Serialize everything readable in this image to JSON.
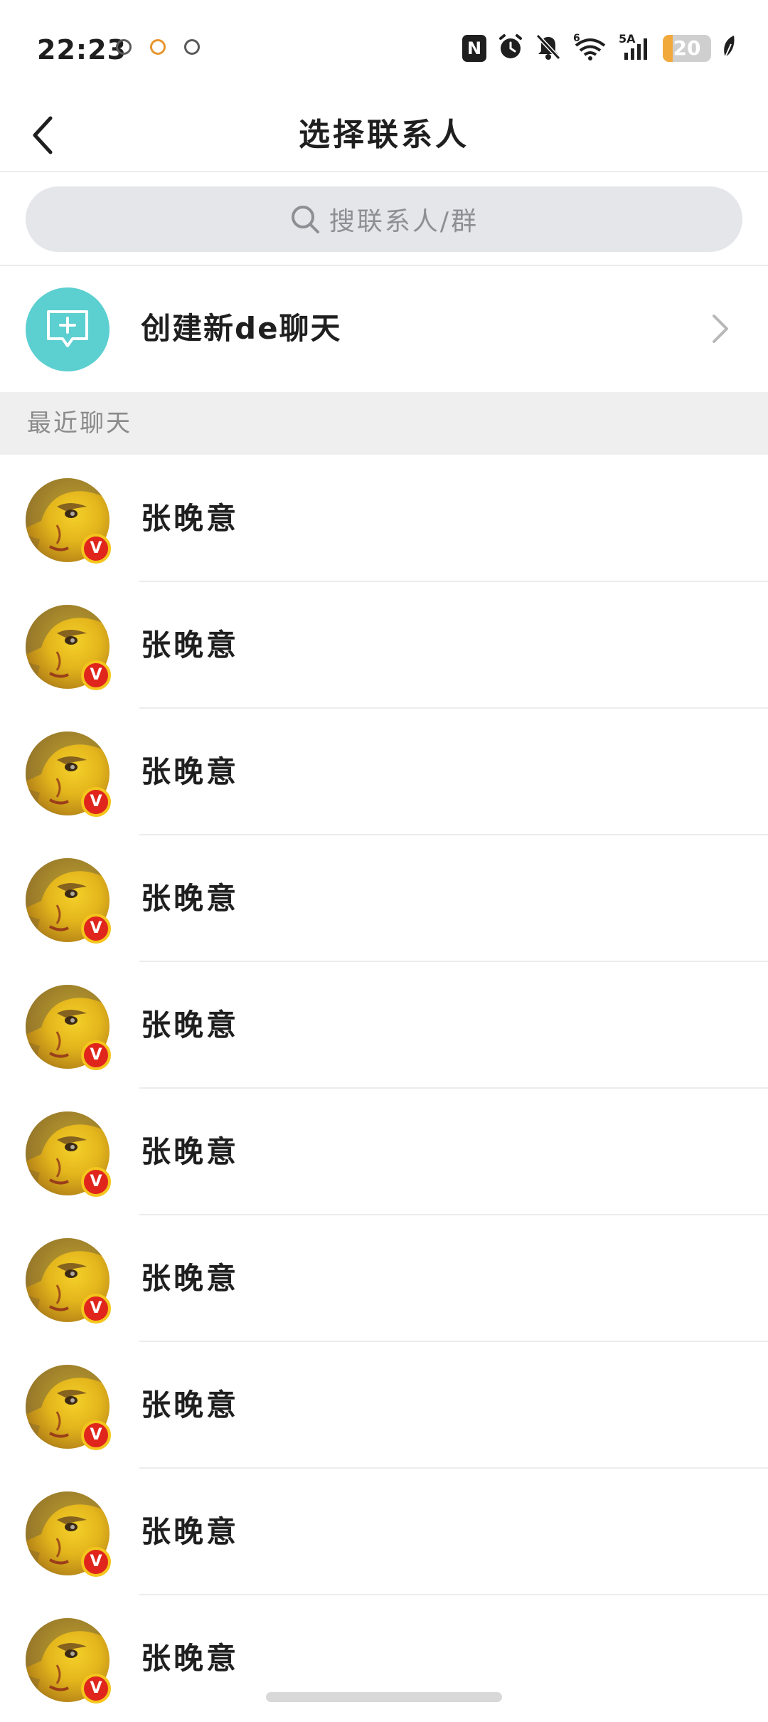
{
  "status_bar": {
    "time": "22:23",
    "network_label": "5A",
    "wifi_label": "6",
    "battery_text": "20",
    "battery_level_percent": 20,
    "app_icons": [
      "notification-app-icon",
      "notification-app-icon",
      "notification-app-icon"
    ],
    "right_icons": [
      "nfc-icon",
      "alarm-icon",
      "mute-icon",
      "wifi-icon",
      "signal-icon",
      "battery-icon",
      "leaf-icon"
    ]
  },
  "header": {
    "title": "选择联系人",
    "back_icon": "back-arrow-icon"
  },
  "search": {
    "placeholder": "搜联系人/群",
    "icon": "search-icon"
  },
  "create_chat": {
    "label": "创建新de聊天",
    "icon": "add-chat-icon",
    "accent_color": "#5ccfd0"
  },
  "recent_section": {
    "title": "最近聊天"
  },
  "contacts": [
    {
      "name": "张晚意",
      "badge": "V"
    },
    {
      "name": "张晚意",
      "badge": "V"
    },
    {
      "name": "张晚意",
      "badge": "V"
    },
    {
      "name": "张晚意",
      "badge": "V"
    },
    {
      "name": "张晚意",
      "badge": "V"
    },
    {
      "name": "张晚意",
      "badge": "V"
    },
    {
      "name": "张晚意",
      "badge": "V"
    },
    {
      "name": "张晚意",
      "badge": "V"
    },
    {
      "name": "张晚意",
      "badge": "V"
    },
    {
      "name": "张晚意",
      "badge": "V"
    }
  ],
  "colors": {
    "badge_red": "#e0261c",
    "badge_ring": "#f4c51c",
    "battery_fill": "#f2a93b"
  }
}
